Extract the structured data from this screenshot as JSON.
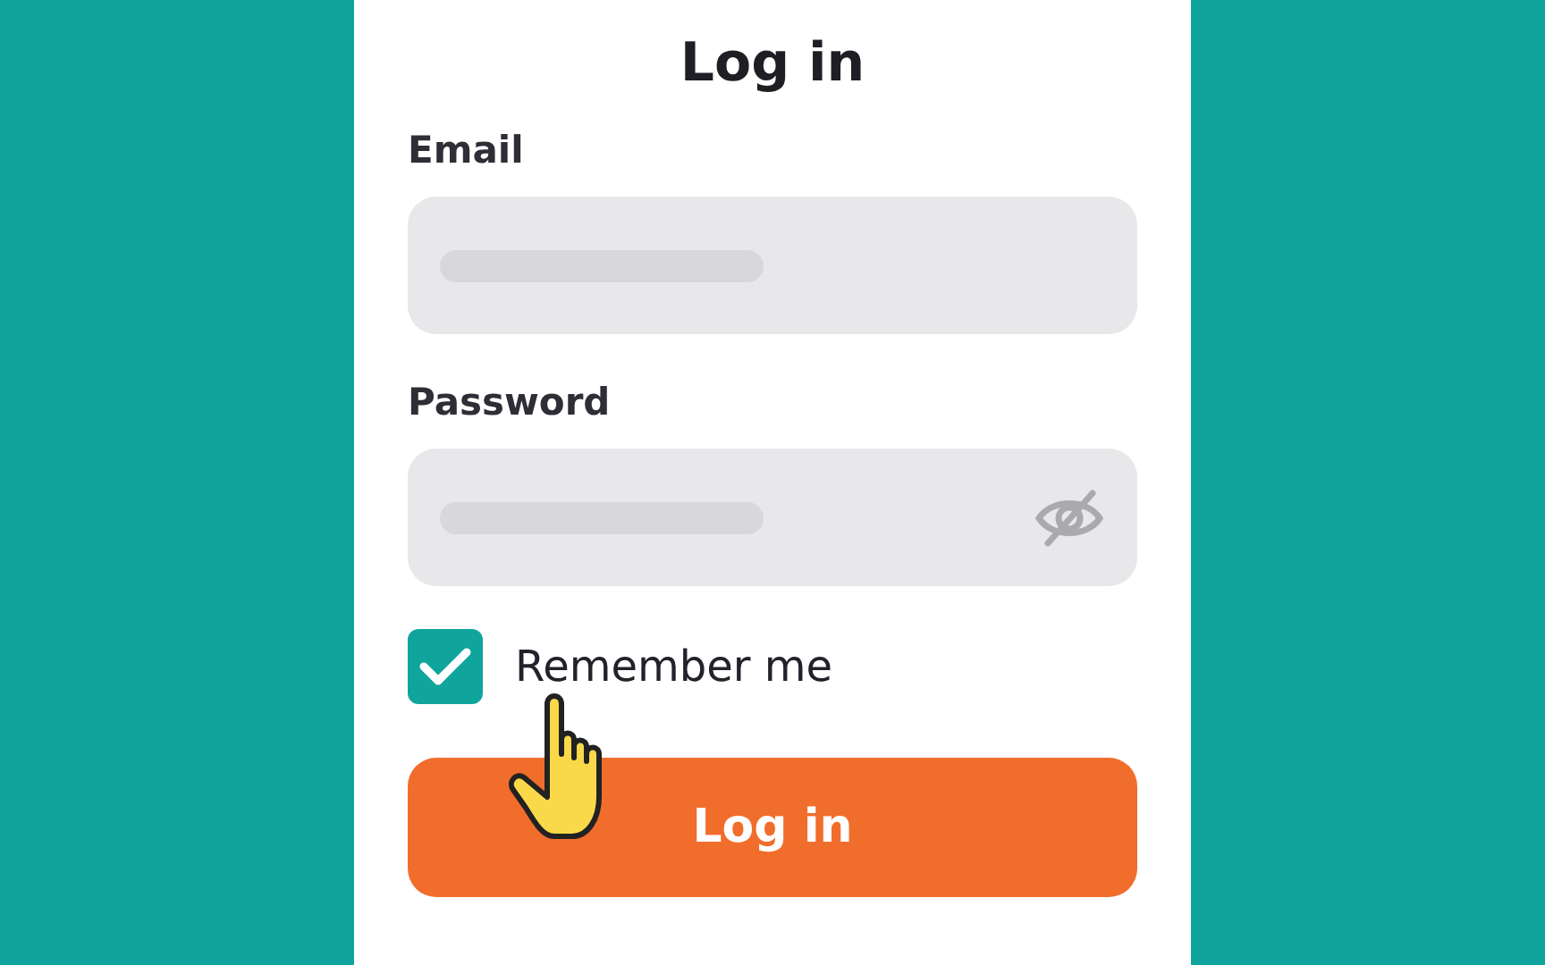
{
  "title": "Log in",
  "fields": [
    {
      "label": "Email",
      "kind": "text"
    },
    {
      "label": "Password",
      "kind": "password"
    }
  ],
  "remember": {
    "label": "Remember me",
    "checked": true
  },
  "submit": {
    "label": "Log in"
  }
}
